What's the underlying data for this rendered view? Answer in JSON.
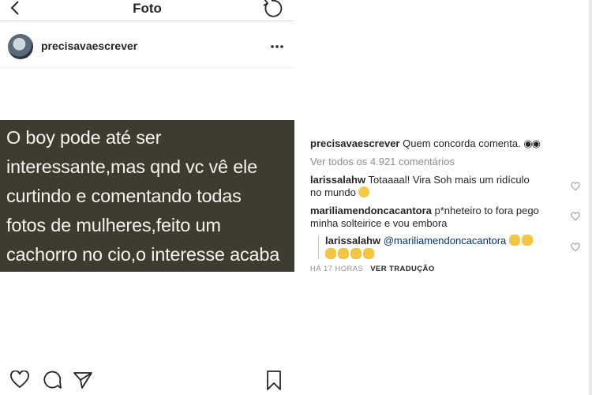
{
  "topbar": {
    "title": "Foto"
  },
  "post": {
    "username": "precisavaescrever",
    "image_text_lines": [
      "O boy pode até  ser",
      "interessante,mas qnd vc vê ele",
      "curtindo e comentando todas",
      "fotos de mulheres,feito um",
      "cachorro no cio,o interesse acaba"
    ]
  },
  "comments": {
    "caption_user": "precisavaescrever",
    "caption_text": "Quem concorda comenta.",
    "view_all": "Ver todos os 4.921 comentários",
    "items": [
      {
        "user": "larissalahw",
        "text_line1": "Totaaaal! Vira Soh mais um ridículo",
        "text_line2": "no mundo"
      },
      {
        "user": "mariliamendoncacantora",
        "text_line1": "p*nheteiro to fora pego",
        "text_line2": "minha solteirice e vou embora"
      },
      {
        "user": "larissalahw",
        "mention": "@mariliamendoncacantora"
      }
    ],
    "time": "HÁ 17 HORAS",
    "translate": "VER TRADUÇÃO"
  },
  "icons": {
    "back": "chevron-left-icon",
    "rotate": "rotate-icon",
    "more": "more-horizontal-icon",
    "like": "heart-icon",
    "comment": "comment-bubble-icon",
    "share": "paper-plane-icon",
    "save": "bookmark-icon"
  }
}
